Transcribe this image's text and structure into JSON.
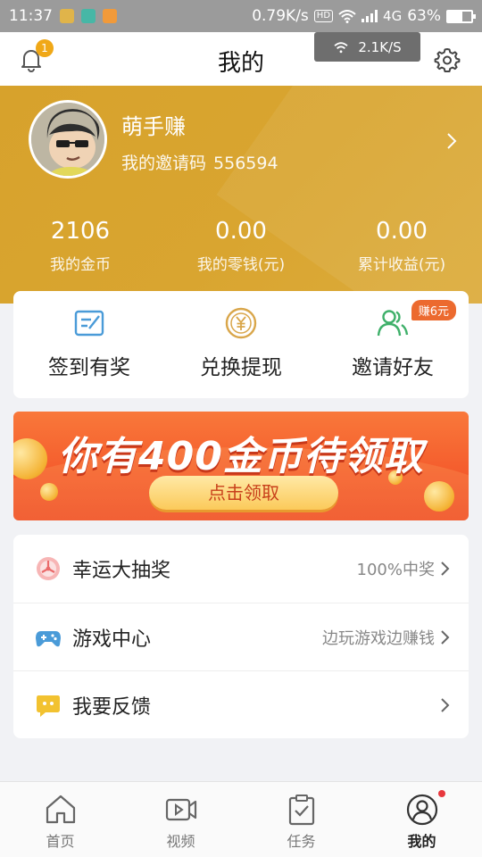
{
  "status_bar": {
    "time": "11:37",
    "net_speed": "0.79K/s",
    "hd": "HD",
    "network": "4G",
    "battery": "63%",
    "battery_level": 0.63
  },
  "header": {
    "title": "我的",
    "notification_count": "1",
    "network_toast": "2.1K/S"
  },
  "profile": {
    "name": "萌手赚",
    "invite_label": "我的邀请码",
    "invite_code": "556594"
  },
  "stats": [
    {
      "value": "2106",
      "label": "我的金币"
    },
    {
      "value": "0.00",
      "label": "我的零钱(元)"
    },
    {
      "value": "0.00",
      "label": "累计收益(元)"
    }
  ],
  "actions": [
    {
      "label": "签到有奖",
      "icon": "sign-in-icon"
    },
    {
      "label": "兑换提现",
      "icon": "yuan-coin-icon"
    },
    {
      "label": "邀请好友",
      "icon": "invite-friends-icon",
      "badge": "赚6元"
    }
  ],
  "banner": {
    "title": "你有400金币待领取",
    "button": "点击领取"
  },
  "menu": [
    {
      "label": "幸运大抽奖",
      "hint": "100%中奖",
      "icon": "lottery-icon"
    },
    {
      "label": "游戏中心",
      "hint": "边玩游戏边赚钱",
      "icon": "gamepad-icon"
    },
    {
      "label": "我要反馈",
      "hint": "",
      "icon": "feedback-icon"
    }
  ],
  "tabs": [
    {
      "label": "首页",
      "icon": "home-icon"
    },
    {
      "label": "视频",
      "icon": "video-icon"
    },
    {
      "label": "任务",
      "icon": "task-icon"
    },
    {
      "label": "我的",
      "icon": "profile-icon",
      "active": true
    }
  ],
  "colors": {
    "brand": "#d9a530",
    "accent_orange": "#ec6a2f",
    "badge_yellow": "#f0a817",
    "icon_blue": "#4a9bd8",
    "icon_gold": "#d9a64a",
    "icon_green": "#3fb06a"
  }
}
